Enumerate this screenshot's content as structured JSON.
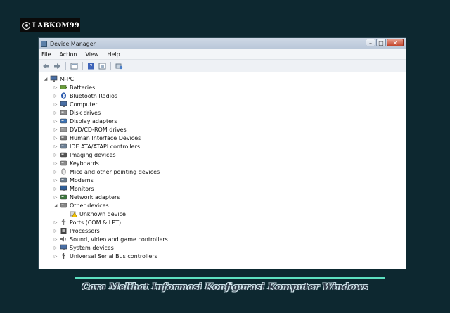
{
  "brand": {
    "logo_text": "LABKOM99"
  },
  "window": {
    "title": "Device Manager",
    "controls": {
      "minimize": "–",
      "maximize": "□",
      "close": "✕"
    }
  },
  "menu": [
    "File",
    "Action",
    "View",
    "Help"
  ],
  "toolbar": [
    "back-icon",
    "forward-icon",
    "properties-icon",
    "help-icon",
    "scan-icon",
    "update-driver-icon"
  ],
  "tree": {
    "root": "M-PC",
    "categories": [
      {
        "label": "Batteries",
        "icon": "battery-icon"
      },
      {
        "label": "Bluetooth Radios",
        "icon": "bluetooth-icon"
      },
      {
        "label": "Computer",
        "icon": "computer-icon"
      },
      {
        "label": "Disk drives",
        "icon": "disk-drive-icon"
      },
      {
        "label": "Display adapters",
        "icon": "display-adapter-icon"
      },
      {
        "label": "DVD/CD-ROM drives",
        "icon": "dvd-drive-icon"
      },
      {
        "label": "Human Interface Devices",
        "icon": "hid-icon"
      },
      {
        "label": "IDE ATA/ATAPI controllers",
        "icon": "ide-controller-icon"
      },
      {
        "label": "Imaging devices",
        "icon": "camera-icon"
      },
      {
        "label": "Keyboards",
        "icon": "keyboard-icon"
      },
      {
        "label": "Mice and other pointing devices",
        "icon": "mouse-icon"
      },
      {
        "label": "Modems",
        "icon": "modem-icon"
      },
      {
        "label": "Monitors",
        "icon": "monitor-icon"
      },
      {
        "label": "Network adapters",
        "icon": "network-icon"
      },
      {
        "label": "Other devices",
        "icon": "other-devices-icon",
        "expanded": true,
        "children": [
          {
            "label": "Unknown device",
            "icon": "warning-device-icon"
          }
        ]
      },
      {
        "label": "Ports (COM & LPT)",
        "icon": "port-icon"
      },
      {
        "label": "Processors",
        "icon": "processor-icon"
      },
      {
        "label": "Sound, video and game controllers",
        "icon": "sound-icon"
      },
      {
        "label": "System devices",
        "icon": "system-device-icon"
      },
      {
        "label": "Universal Serial Bus controllers",
        "icon": "usb-icon"
      }
    ]
  },
  "caption": "Cara Melihat Informasi Konfigurasi Komputer Windows"
}
